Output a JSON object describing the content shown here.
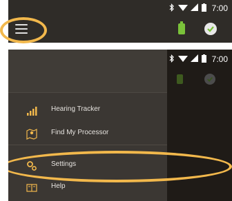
{
  "status_bar": {
    "time": "7:00"
  },
  "drawer": {
    "items": [
      {
        "label": "Hearing Tracker",
        "icon": "signal-bars-icon"
      },
      {
        "label": "Find My Processor",
        "icon": "map-pin-icon"
      },
      {
        "label": "Settings",
        "icon": "settings-gears-icon"
      },
      {
        "label": "Help",
        "icon": "help-book-icon"
      }
    ]
  },
  "colors": {
    "accent": "#f2b84c",
    "battery": "#7ac23a",
    "app_bar": "#2f2c28",
    "drawer": "#3b3733"
  }
}
